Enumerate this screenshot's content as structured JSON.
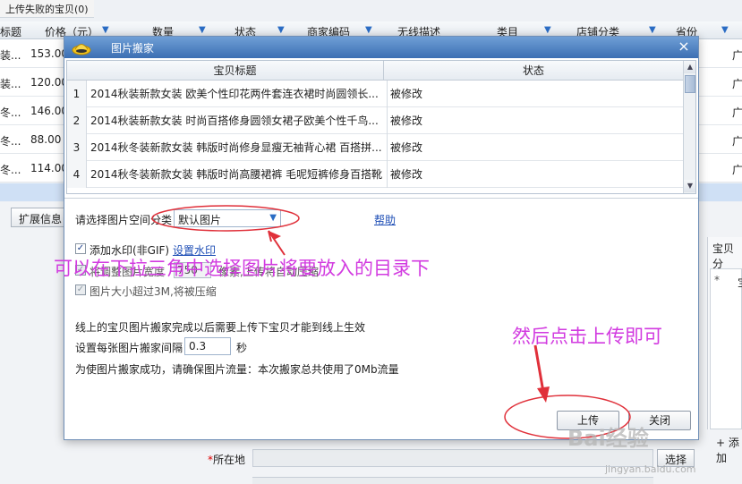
{
  "background": {
    "tab_label": "上传失败的宝贝(0)",
    "columns": [
      "标题",
      "价格（元）",
      "数量",
      "状态",
      "商家编码",
      "无线描述",
      "类目",
      "店铺分类",
      "省份"
    ],
    "rows": [
      {
        "title": "装...",
        "price": "153.00",
        "tail": "广"
      },
      {
        "title": "装...",
        "price": "120.00",
        "tail": "广"
      },
      {
        "title": "冬...",
        "price": "146.00",
        "tail": "广"
      },
      {
        "title": "冬...",
        "price": "88.00",
        "tail": "广"
      },
      {
        "title": "冬...",
        "price": "114.00",
        "tail": "广"
      }
    ],
    "ext_button": "扩展信息",
    "right_panel_label": "宝贝分",
    "right_panel_star": "*",
    "right_panel_inner": "宝",
    "add_label": "+ 添加",
    "location_star": "*",
    "location_label": "所在地",
    "select_button": "选择"
  },
  "dialog": {
    "title": "图片搬家",
    "close": "×",
    "grid": {
      "col_title": "宝贝标题",
      "col_status": "状态",
      "rows": [
        {
          "num": "1",
          "title": "2014秋装新款女装 欧美个性印花两件套连衣裙时尚圆领长...",
          "status": "被修改"
        },
        {
          "num": "2",
          "title": "2014秋装新款女装 时尚百搭修身圆领女裙子欧美个性千鸟...",
          "status": "被修改"
        },
        {
          "num": "3",
          "title": "2014秋冬装新款女装 韩版时尚修身显瘦无袖背心裙 百搭拼...",
          "status": "被修改"
        },
        {
          "num": "4",
          "title": "2014秋冬装新款女装 韩版时尚高腰裙裤 毛呢短裤修身百搭靴裤",
          "status": "被修改"
        }
      ]
    },
    "category_label": "请选择图片空间分类",
    "category_value": "默认图片",
    "help": "帮助",
    "watermark_checkbox": "添加水印(非GIF)",
    "watermark_link": "设置水印",
    "resize_label": "将调整图片宽度",
    "resize_value": "750",
    "resize_suffix": "像素,上传将自动压缩",
    "compress_label": "图片大小超过3M,将被压缩",
    "note_online": "线上的宝贝图片搬家完成以后需要上传下宝贝才能到线上生效",
    "interval_label": "设置每张图片搬家间隔",
    "interval_value": "0.3",
    "interval_unit": "秒",
    "traffic_note": "为使图片搬家成功，请确保图片流量：本次搬家总共使用了0Mb流量",
    "upload_button": "上传",
    "close_button": "关闭"
  },
  "annotations": {
    "tip_dropdown": "可以在下拉三角中选择图片将要放入的目录下",
    "tip_upload": "然后点击上传即可",
    "color": "#d23be0"
  },
  "watermark": {
    "logo": "Bai经验",
    "sub": "jingyan.baidu.com"
  }
}
